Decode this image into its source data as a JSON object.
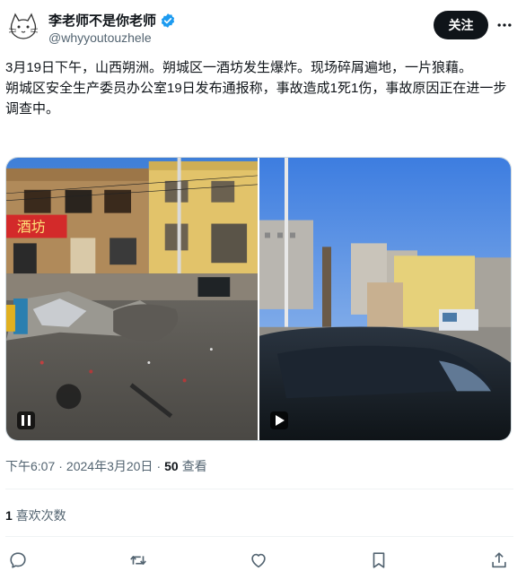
{
  "author": {
    "display_name": "李老师不是你老师",
    "handle": "@whyyoutouzhele",
    "verified": true,
    "avatar_icon": "cat-sketch-avatar"
  },
  "header": {
    "follow_label": "关注",
    "more_icon": "more-horizontal-icon"
  },
  "tweet": {
    "paragraph_1": "3月19日下午，山西朔洲。朔城区一酒坊发生爆炸。现场碎屑遍地，一片狼藉。",
    "paragraph_2": "朔城区安全生产委员办公室19日发布通报称，事故造成1死1伤，事故原因正在进一步调查中。"
  },
  "media": {
    "left_sign_text": "酒坊",
    "left_badge_icon": "pause-icon",
    "right_badge_icon": "play-icon"
  },
  "meta": {
    "time": "下午6:07",
    "separator_1": "·",
    "date": "2024年3月20日",
    "separator_2": "·",
    "views_count": "50",
    "views_label": "查看"
  },
  "likes": {
    "count": "1",
    "label": "喜欢次数"
  },
  "actions": [
    {
      "icon": "reply-icon"
    },
    {
      "icon": "retweet-icon"
    },
    {
      "icon": "like-icon"
    },
    {
      "icon": "bookmark-icon"
    },
    {
      "icon": "share-icon"
    }
  ],
  "colors": {
    "text_primary": "#0f1419",
    "text_secondary": "#536471",
    "verified_blue": "#1d9bf0",
    "follow_bg": "#0f1419",
    "divider": "#eff3f4"
  }
}
